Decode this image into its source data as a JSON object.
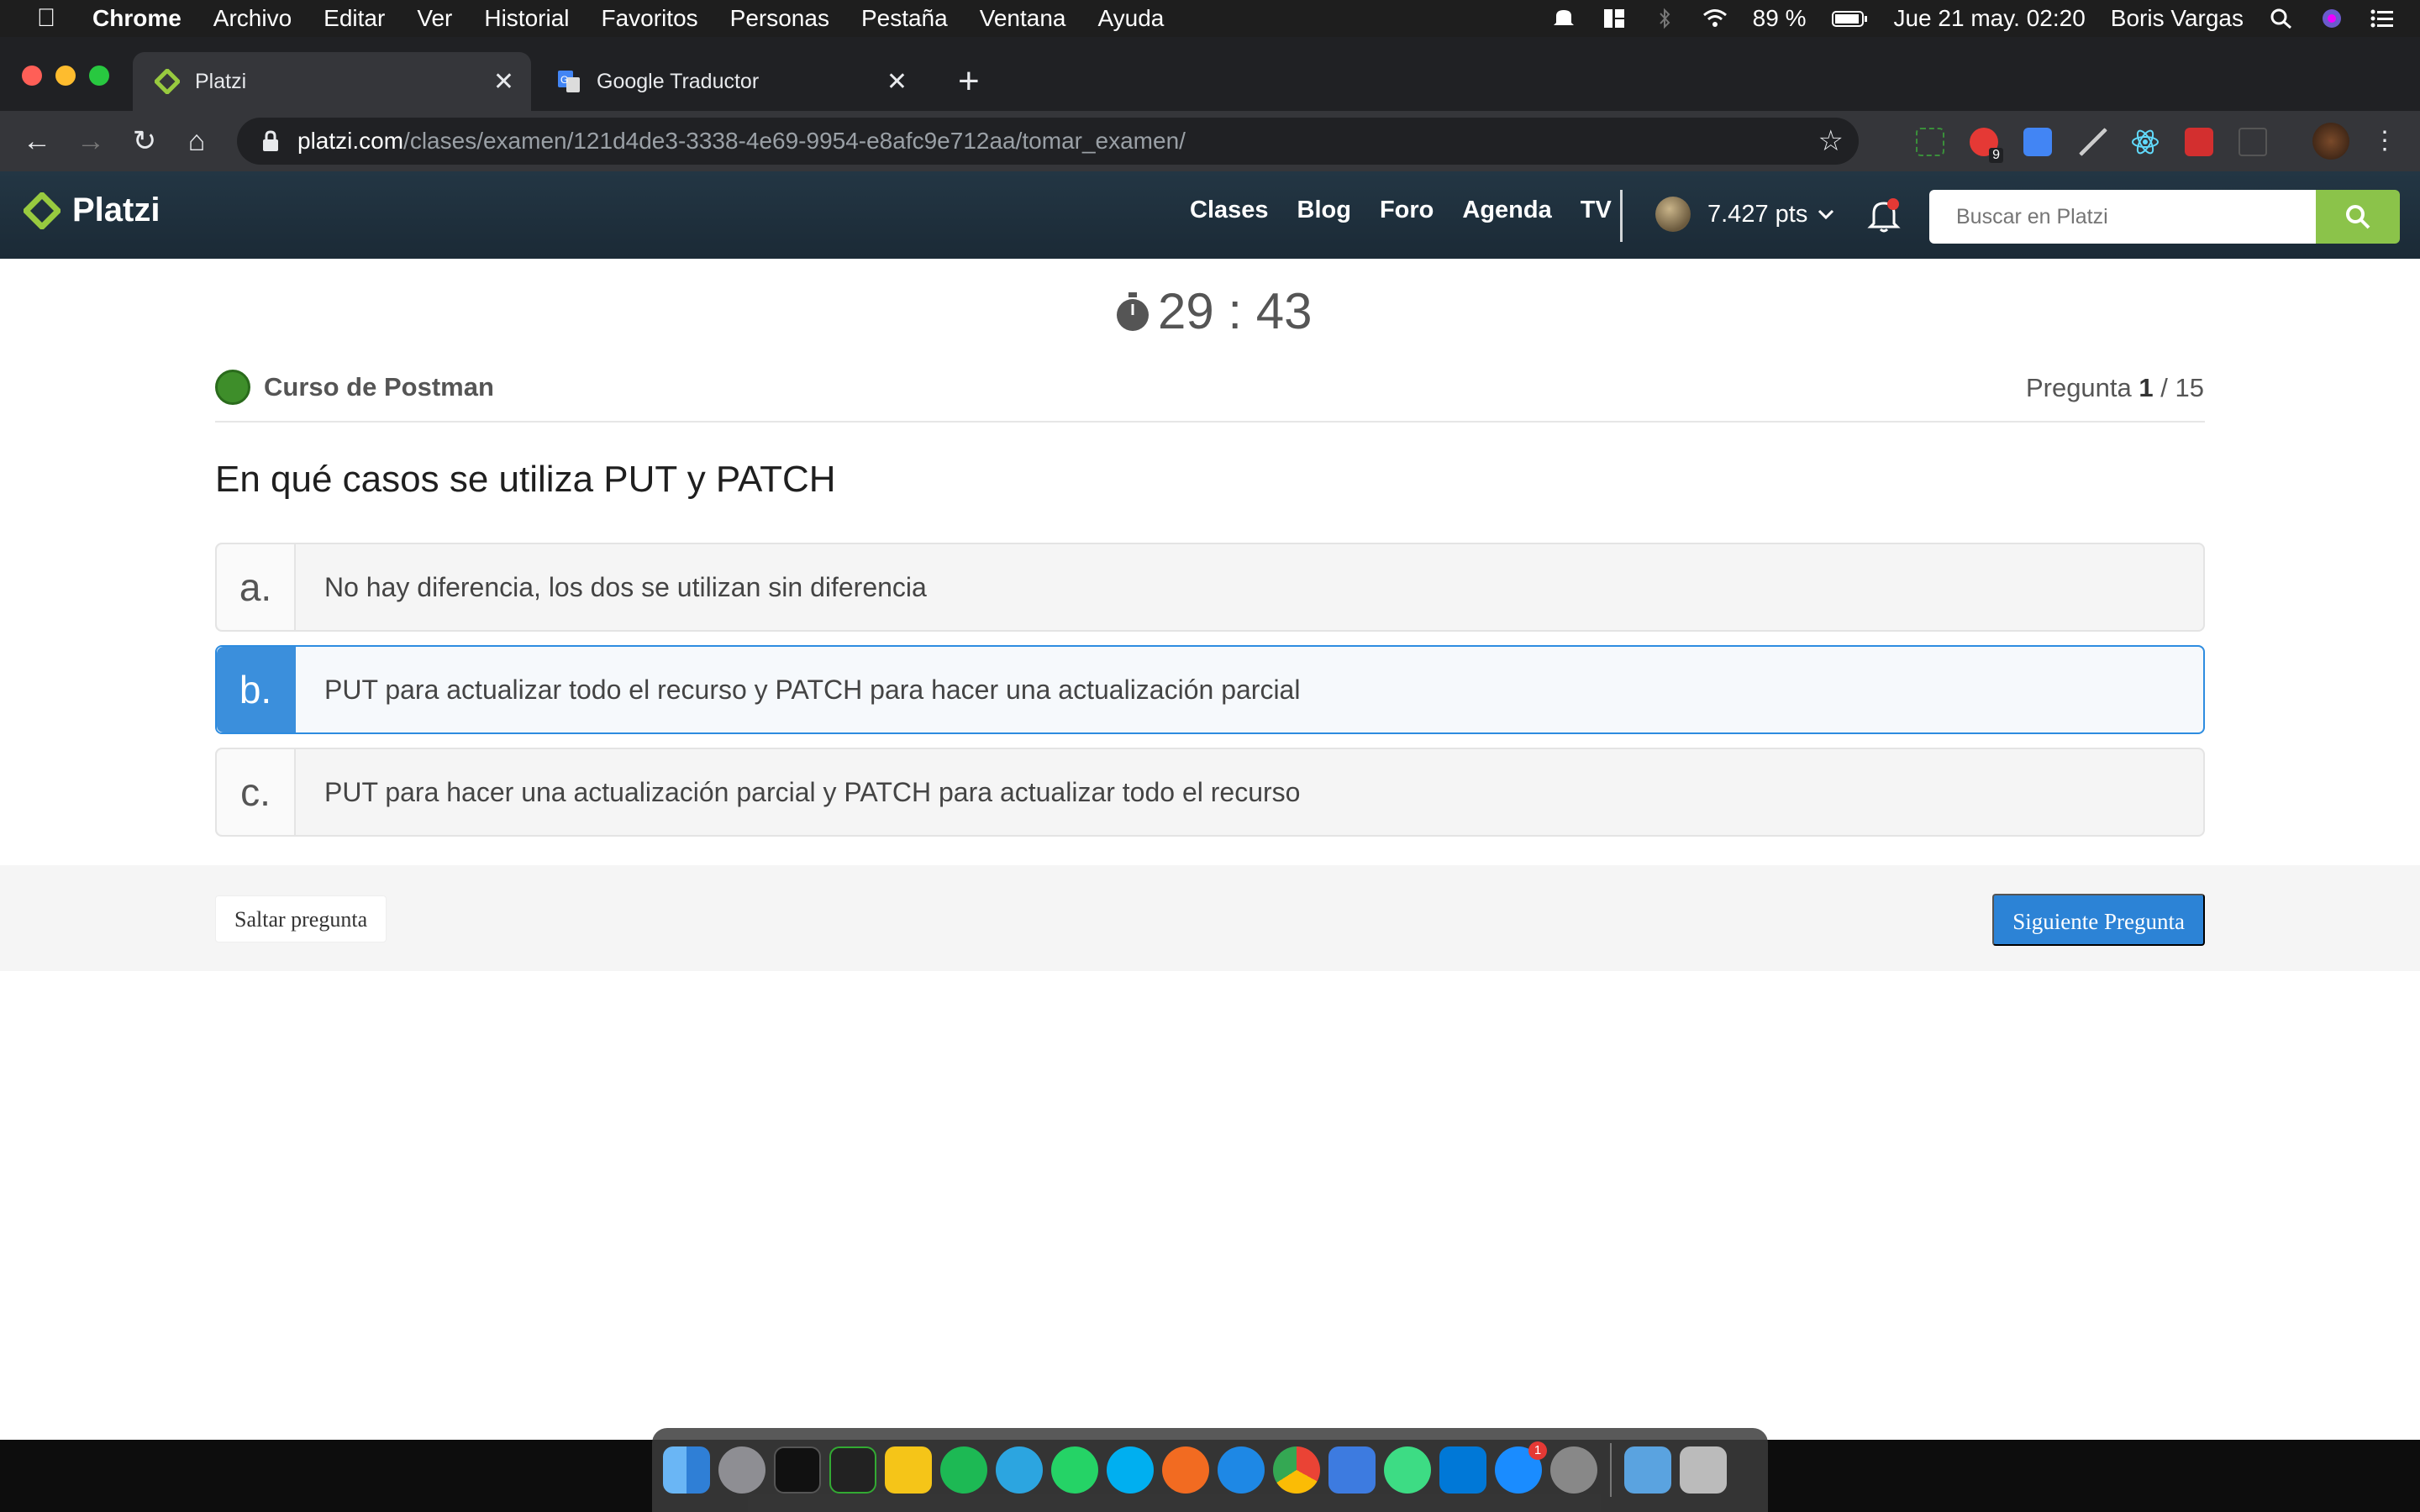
{
  "menubar": {
    "app": "Chrome",
    "items": [
      "Archivo",
      "Editar",
      "Ver",
      "Historial",
      "Favoritos",
      "Personas",
      "Pestaña",
      "Ventana",
      "Ayuda"
    ],
    "battery": "89 %",
    "datetime": "Jue 21 may.  02:20",
    "user": "Boris Vargas"
  },
  "browser": {
    "tabs": [
      {
        "title": "Platzi",
        "active": true
      },
      {
        "title": "Google Traductor",
        "active": false
      }
    ],
    "url_host": "platzi.com",
    "url_path": "/clases/examen/121d4de3-3338-4e69-9954-e8afc9e712aa/tomar_examen/",
    "extension_badge": "9"
  },
  "site": {
    "logo": "Platzi",
    "nav": [
      "Clases",
      "Blog",
      "Foro",
      "Agenda",
      "TV"
    ],
    "points": "7.427 pts",
    "search_placeholder": "Buscar en Platzi"
  },
  "exam": {
    "timer": "29 : 43",
    "course": "Curso de Postman",
    "question_label": "Pregunta",
    "question_current": "1",
    "question_total": "/ 15",
    "question": "En qué casos se utiliza PUT y PATCH",
    "options": [
      {
        "letter": "a.",
        "text": "No hay diferencia, los dos se utilizan sin diferencia",
        "selected": false
      },
      {
        "letter": "b.",
        "text": "PUT para actualizar todo el recurso y PATCH para hacer una actualización parcial",
        "selected": true
      },
      {
        "letter": "c.",
        "text": "PUT para hacer una actualización parcial y PATCH para actualizar todo el recurso",
        "selected": false
      }
    ],
    "skip_label": "Saltar pregunta",
    "next_label": "Siguiente Pregunta"
  },
  "dock": {
    "appstore_badge": "1"
  },
  "colors": {
    "accent_blue": "#3b8fdc",
    "platzi_green": "#8bc34a",
    "nav_bg": "#1e2f3b"
  }
}
